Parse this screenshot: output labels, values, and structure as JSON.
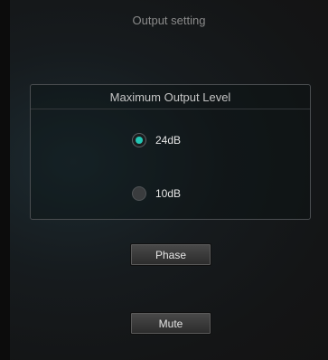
{
  "header": {
    "title": "Output setting"
  },
  "output_level": {
    "title": "Maximum Output Level",
    "options": [
      {
        "label": "24dB",
        "selected": true
      },
      {
        "label": "10dB",
        "selected": false
      }
    ],
    "accent_color": "#23c6b4"
  },
  "buttons": {
    "phase_label": "Phase",
    "mute_label": "Mute"
  }
}
